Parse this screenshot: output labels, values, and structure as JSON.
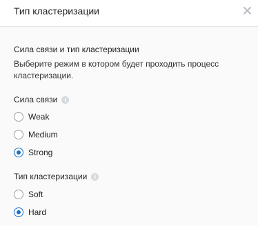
{
  "dialog": {
    "title": "Тип кластеризации",
    "close_icon": "close-icon",
    "section_title": "Сила связи и тип кластеризации",
    "description": "Выберите режим в котором будет проходить процесс кластеризации."
  },
  "strength": {
    "label": "Сила связи",
    "info_icon": "info-icon",
    "options": [
      {
        "label": "Weak",
        "selected": false
      },
      {
        "label": "Medium",
        "selected": false
      },
      {
        "label": "Strong",
        "selected": true
      }
    ]
  },
  "clustering_type": {
    "label": "Тип кластеризации",
    "info_icon": "info-icon",
    "options": [
      {
        "label": "Soft",
        "selected": false
      },
      {
        "label": "Hard",
        "selected": true
      }
    ]
  },
  "colors": {
    "accent": "#1a73c4",
    "body_background": "#fafafa"
  }
}
